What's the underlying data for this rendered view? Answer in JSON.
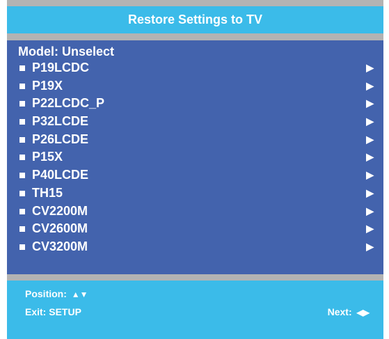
{
  "title": "Restore Settings to TV",
  "model_label": "Model: Unselect",
  "items": [
    {
      "label": "P19LCDC"
    },
    {
      "label": "P19X"
    },
    {
      "label": "P22LCDC_P"
    },
    {
      "label": "P32LCDE"
    },
    {
      "label": "P26LCDE"
    },
    {
      "label": "P15X"
    },
    {
      "label": "P40LCDE"
    },
    {
      "label": "TH15"
    },
    {
      "label": "CV2200M"
    },
    {
      "label": "CV2600M"
    },
    {
      "label": "CV3200M"
    }
  ],
  "item_arrow": "▶",
  "footer": {
    "position_label": "Position:",
    "position_symbols": "▲▼",
    "exit_label": "Exit: SETUP",
    "next_label": "Next:",
    "next_symbols": "◀▶"
  },
  "colors": {
    "background": "#3bbbe9",
    "list_panel": "#4363ad",
    "separator": "#b3b3b3",
    "text": "#ffffff"
  }
}
